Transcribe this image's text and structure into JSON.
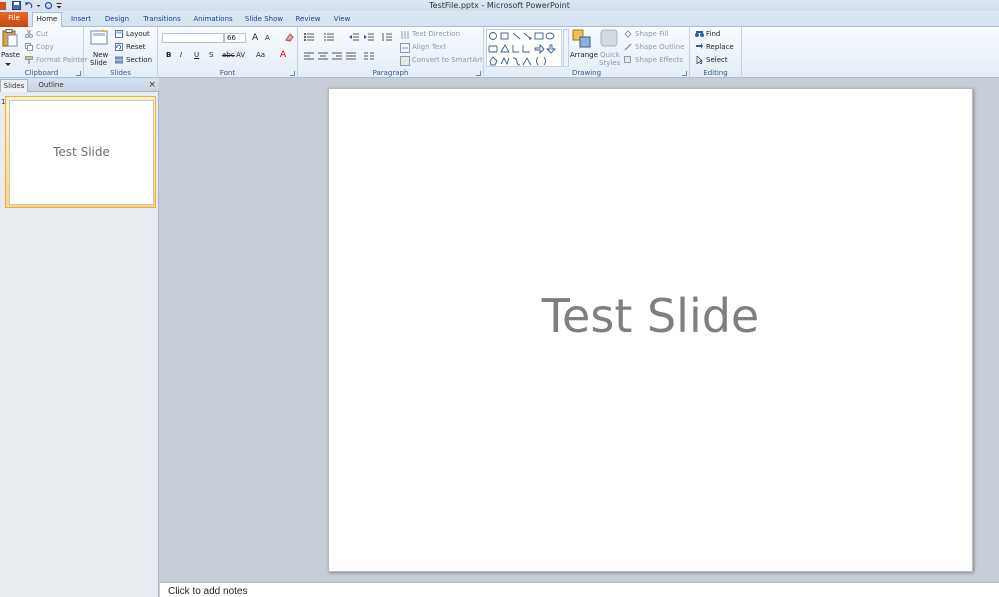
{
  "window": {
    "title": "TestFile.pptx - Microsoft PowerPoint"
  },
  "tabs": [
    "File",
    "Home",
    "Insert",
    "Design",
    "Transitions",
    "Animations",
    "Slide Show",
    "Review",
    "View"
  ],
  "ribbon": {
    "clipboard": {
      "label": "Clipboard",
      "paste": "Paste",
      "cut": "Cut",
      "copy": "Copy",
      "format_painter": "Format Painter"
    },
    "slides": {
      "label": "Slides",
      "new_slide": "New",
      "new_slide2": "Slide",
      "layout": "Layout",
      "reset": "Reset",
      "section": "Section"
    },
    "font": {
      "label": "Font",
      "font_name": "",
      "font_size": "66",
      "bold": "B",
      "italic": "I",
      "underline": "U",
      "strike": "S",
      "abc": "abc",
      "av": "AV",
      "aa": "Aa",
      "grow": "A",
      "shrink": "A",
      "color": "A"
    },
    "paragraph": {
      "label": "Paragraph",
      "text_direction": "Text Direction",
      "align_text": "Align Text",
      "convert_smartart": "Convert to SmartArt"
    },
    "drawing": {
      "label": "Drawing",
      "arrange": "Arrange",
      "quick": "Quick",
      "styles": "Styles",
      "shape_fill": "Shape Fill",
      "shape_outline": "Shape Outline",
      "shape_effects": "Shape Effects"
    },
    "editing": {
      "label": "Editing",
      "find": "Find",
      "replace": "Replace",
      "select": "Select"
    }
  },
  "panel": {
    "tab_slides": "Slides",
    "tab_outline": "Outline",
    "close": "×",
    "slide_number": "1",
    "thumb_title": "Test Slide"
  },
  "slide": {
    "title": "Test Slide"
  },
  "notes": {
    "placeholder": "Click to add notes"
  },
  "colors": {
    "file_tab": "#d0521b",
    "tab_text": "#15428b",
    "selected_thumb": "#fbd87a"
  }
}
